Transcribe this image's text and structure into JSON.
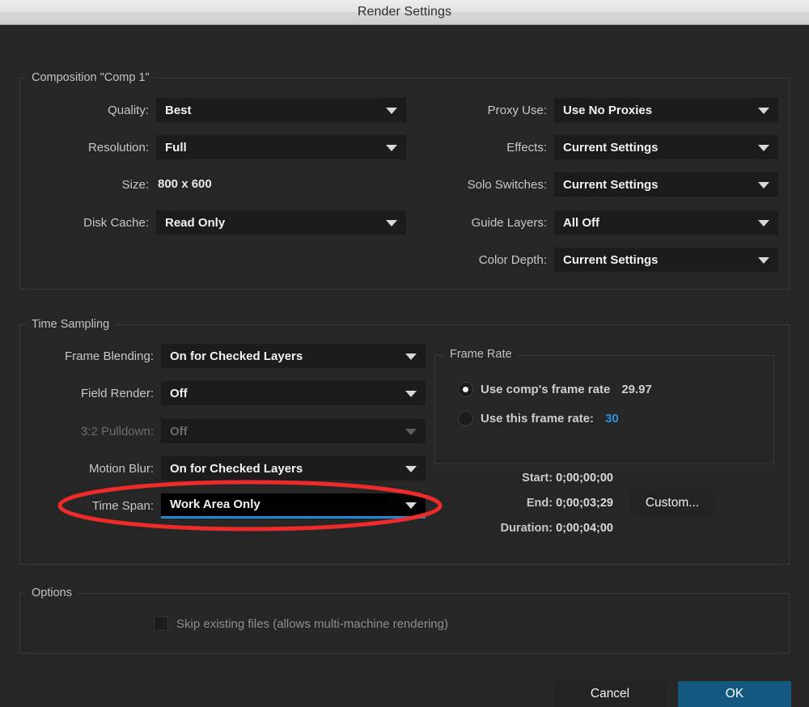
{
  "window": {
    "title": "Render Settings"
  },
  "composition": {
    "legend": "Composition \"Comp 1\"",
    "left_rows": [
      {
        "label": "Quality:",
        "value": "Best",
        "control": "dropdown",
        "disabled": false
      },
      {
        "label": "Resolution:",
        "value": "Full",
        "control": "dropdown",
        "disabled": false
      },
      {
        "label": "Size:",
        "value": "800 x 600",
        "control": "text",
        "disabled": false
      },
      {
        "label": "Disk Cache:",
        "value": "Read Only",
        "control": "dropdown",
        "disabled": false
      }
    ],
    "right_rows": [
      {
        "label": "Proxy Use:",
        "value": "Use No Proxies",
        "control": "dropdown",
        "disabled": false
      },
      {
        "label": "Effects:",
        "value": "Current Settings",
        "control": "dropdown",
        "disabled": false
      },
      {
        "label": "Solo Switches:",
        "value": "Current Settings",
        "control": "dropdown",
        "disabled": false
      },
      {
        "label": "Guide Layers:",
        "value": "All Off",
        "control": "dropdown",
        "disabled": false
      },
      {
        "label": "Color Depth:",
        "value": "Current Settings",
        "control": "dropdown",
        "disabled": false
      }
    ]
  },
  "time_sampling": {
    "legend": "Time Sampling",
    "rows": [
      {
        "label": "Frame Blending:",
        "value": "On for Checked Layers",
        "disabled": false,
        "focused": false
      },
      {
        "label": "Field Render:",
        "value": "Off",
        "disabled": false,
        "focused": false
      },
      {
        "label": "3:2 Pulldown:",
        "value": "Off",
        "disabled": true,
        "focused": false
      },
      {
        "label": "Motion Blur:",
        "value": "On for Checked Layers",
        "disabled": false,
        "focused": false
      },
      {
        "label": "Time Span:",
        "value": "Work Area Only",
        "disabled": false,
        "focused": true
      }
    ],
    "frame_rate": {
      "legend": "Frame Rate",
      "options": [
        {
          "label": "Use comp's frame rate",
          "value": "29.97",
          "selected": true,
          "accent": false
        },
        {
          "label": "Use this frame rate:",
          "value": "30",
          "selected": false,
          "accent": true
        }
      ]
    },
    "time_info": [
      {
        "label": "Start:",
        "value": "0;00;00;00"
      },
      {
        "label": "End:",
        "value": "0;00;03;29"
      },
      {
        "label": "Duration:",
        "value": "0;00;04;00"
      }
    ],
    "custom_button": "Custom..."
  },
  "options": {
    "legend": "Options",
    "skip_existing": {
      "label": "Skip existing files (allows multi-machine rendering)",
      "checked": false,
      "disabled": true
    }
  },
  "footer": {
    "cancel_label": "Cancel",
    "ok_label": "OK"
  },
  "annotation": {
    "shape": "ellipse",
    "color": "#ee2b2b",
    "target": "Time Span dropdown"
  },
  "colors": {
    "accent_blue": "#2f93d8",
    "ok_button_blue": "#14587f",
    "focus_underline": "#1f8ad0",
    "annotation_red": "#ee2b2b",
    "dialog_background": "#262626",
    "field_background": "#1b1b1b"
  }
}
